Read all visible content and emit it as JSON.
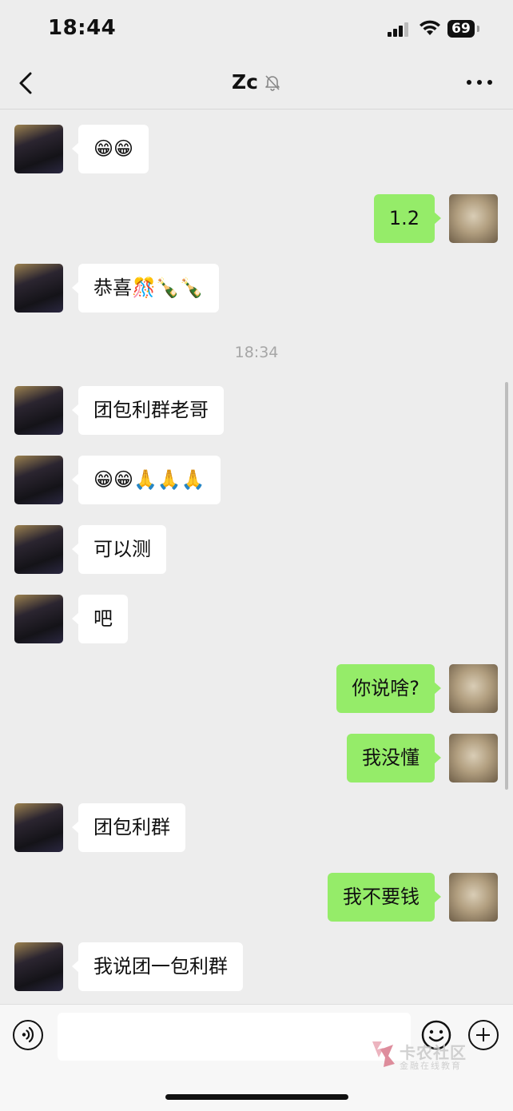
{
  "status": {
    "time": "18:44",
    "battery": "69"
  },
  "header": {
    "title": "Zc"
  },
  "timestamp": "18:34",
  "messages": [
    {
      "side": "left",
      "text": "😁😁"
    },
    {
      "side": "right",
      "text": "1.2"
    },
    {
      "side": "left",
      "text": "恭喜🎊🍾🍾"
    },
    {
      "side": "left",
      "text": "团包利群老哥"
    },
    {
      "side": "left",
      "text": "😁😁🙏🙏🙏"
    },
    {
      "side": "left",
      "text": "可以测"
    },
    {
      "side": "left",
      "text": "吧"
    },
    {
      "side": "right",
      "text": "你说啥?"
    },
    {
      "side": "right",
      "text": "我没懂"
    },
    {
      "side": "left",
      "text": "团包利群"
    },
    {
      "side": "right",
      "text": "我不要钱"
    },
    {
      "side": "left",
      "text": "我说团一包利群"
    }
  ],
  "input": {
    "placeholder": ""
  },
  "watermark": {
    "title": "卡农社区",
    "subtitle": "金融在线教育"
  },
  "colors": {
    "self_bubble": "#95ec69",
    "other_bubble": "#ffffff",
    "background": "#ededed"
  }
}
